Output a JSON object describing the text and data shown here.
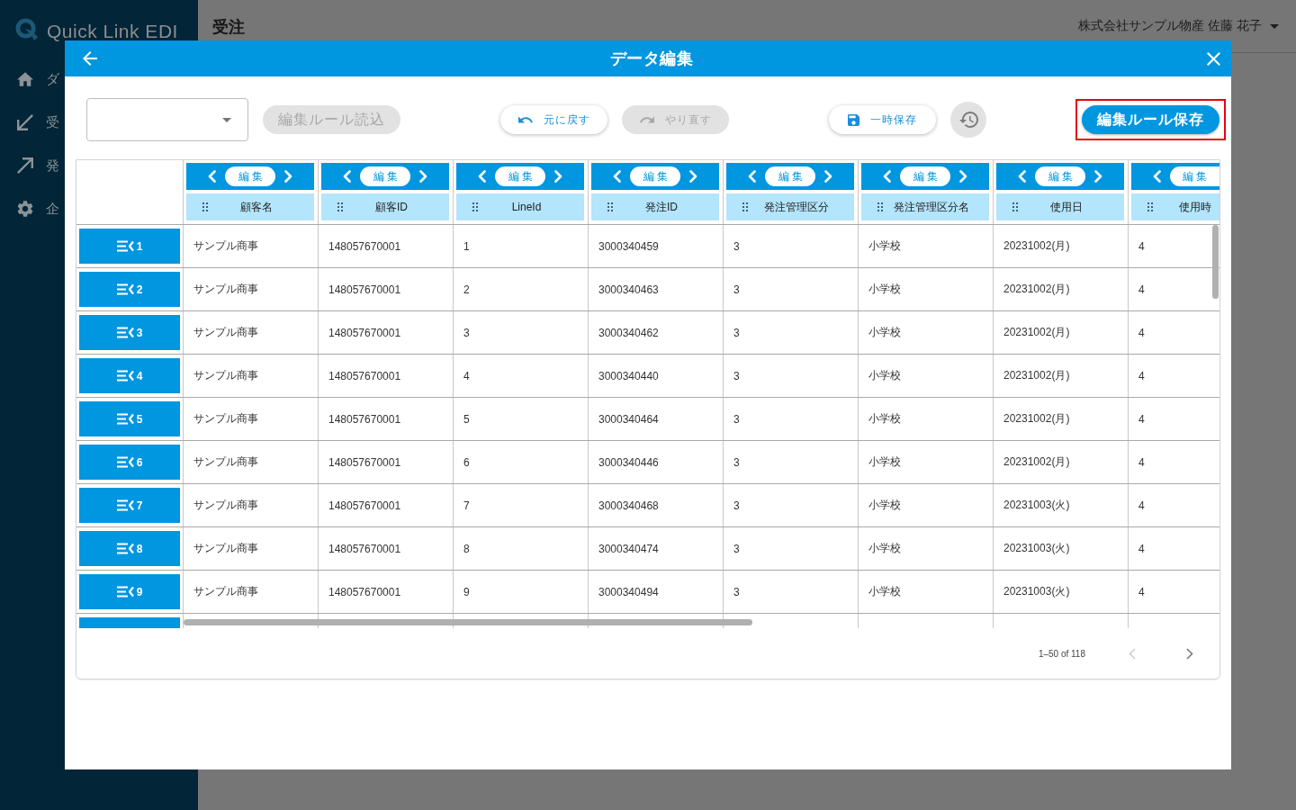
{
  "sidebar": {
    "logo": "Quick Link EDI",
    "items": [
      {
        "label": "ダ"
      },
      {
        "label": "受"
      },
      {
        "label": "発"
      },
      {
        "label": "企"
      }
    ]
  },
  "header": {
    "title": "受注",
    "user": "株式会社サンプル物産 佐藤 花子"
  },
  "dialog": {
    "title": "データ編集",
    "toolbar": {
      "load_rule_button": {
        "label": "編集ルール読込",
        "disabled": true
      },
      "undo_button": {
        "label": "元に戻す",
        "disabled": false
      },
      "redo_button": {
        "label": "やり直す",
        "disabled": true
      },
      "temp_save_button": {
        "label": "一時保存",
        "disabled": false
      },
      "history_button": {
        "disabled": true
      },
      "save_rule_button": {
        "label": "編集ルール保存",
        "highlighted": true
      }
    },
    "table": {
      "columns": [
        {
          "edit_button": "編集",
          "label": "顧客名",
          "cut_off": false
        },
        {
          "edit_button": "編集",
          "label": "顧客ID",
          "cut_off": false
        },
        {
          "edit_button": "編集",
          "label": "LineId",
          "cut_off": false
        },
        {
          "edit_button": "編集",
          "label": "発注ID",
          "cut_off": false
        },
        {
          "edit_button": "編集",
          "label": "発注管理区分",
          "cut_off": false
        },
        {
          "edit_button": "編集",
          "label": "発注管理区分名",
          "cut_off": false
        },
        {
          "edit_button": "編集",
          "label": "使用日",
          "cut_off": false
        },
        {
          "edit_button": "編集",
          "label": "使用時",
          "cut_off": true
        }
      ],
      "rows": [
        {
          "number": "1",
          "cells": [
            "サンプル商事",
            "148057670001",
            "1",
            "3000340459",
            "3",
            "小学校",
            "20231002(月)",
            "4"
          ]
        },
        {
          "number": "2",
          "cells": [
            "サンプル商事",
            "148057670001",
            "2",
            "3000340463",
            "3",
            "小学校",
            "20231002(月)",
            "4"
          ]
        },
        {
          "number": "3",
          "cells": [
            "サンプル商事",
            "148057670001",
            "3",
            "3000340462",
            "3",
            "小学校",
            "20231002(月)",
            "4"
          ]
        },
        {
          "number": "4",
          "cells": [
            "サンプル商事",
            "148057670001",
            "4",
            "3000340440",
            "3",
            "小学校",
            "20231002(月)",
            "4"
          ]
        },
        {
          "number": "5",
          "cells": [
            "サンプル商事",
            "148057670001",
            "5",
            "3000340464",
            "3",
            "小学校",
            "20231002(月)",
            "4"
          ]
        },
        {
          "number": "6",
          "cells": [
            "サンプル商事",
            "148057670001",
            "6",
            "3000340446",
            "3",
            "小学校",
            "20231002(月)",
            "4"
          ]
        },
        {
          "number": "7",
          "cells": [
            "サンプル商事",
            "148057670001",
            "7",
            "3000340468",
            "3",
            "小学校",
            "20231003(火)",
            "4"
          ]
        },
        {
          "number": "8",
          "cells": [
            "サンプル商事",
            "148057670001",
            "8",
            "3000340474",
            "3",
            "小学校",
            "20231003(火)",
            "4"
          ]
        },
        {
          "number": "9",
          "cells": [
            "サンプル商事",
            "148057670001",
            "9",
            "3000340494",
            "3",
            "小学校",
            "20231003(火)",
            "4"
          ]
        }
      ]
    },
    "pagination": {
      "range": "1–50 of 118",
      "previous_disabled": true,
      "next_disabled": false
    }
  }
}
